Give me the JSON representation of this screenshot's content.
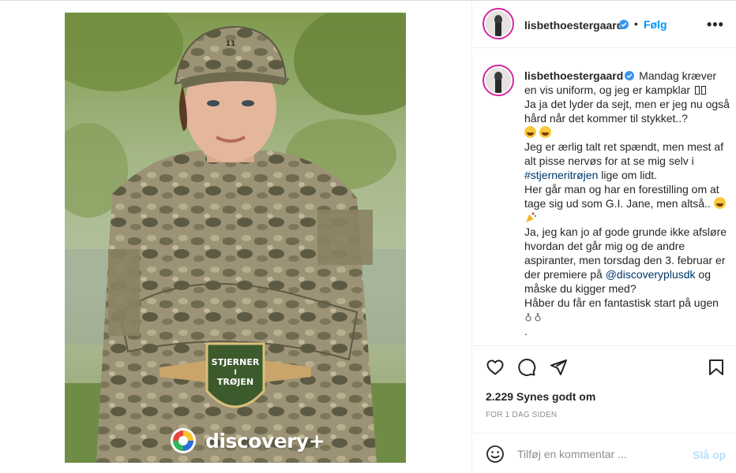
{
  "post": {
    "username": "lisbethoestergaard",
    "follow_label": "Følg",
    "separator": "•",
    "more_label": "•••",
    "media": {
      "badge_line1": "STJERNER",
      "badge_line2": "I",
      "badge_line3": "TRØJEN",
      "brand": "discovery+",
      "cap_number": "11"
    },
    "caption": {
      "line1": "Mandag kræver en vis uniform, og jeg er kampklar",
      "line2": "Ja ja det lyder da sejt, men er jeg nu også hård når det kommer til stykket..?",
      "line3_a": "Jeg er ærlig talt ret spændt, men mest af alt pisse nervøs for at se mig selv i ",
      "hashtag": "#stjerneritrøjen",
      "line3_b": " lige om lidt.",
      "line4": "Her går man og har en forestilling om at tage sig ud som G.I. Jane, men altså..",
      "line5_a": "Ja, jeg kan jo af gode grunde ikke afsløre hvordan det går mig og de andre aspiranter, men torsdag den 3. februar er der premiere på ",
      "mention": "@discoveryplusdk",
      "line5_b": " og måske du kigger med?",
      "line6": "Håber du får en fantastisk start på ugen",
      "line7": "."
    },
    "likes": "2.229 Synes godt om",
    "time": "FOR 1 DAG SIDEN",
    "comment": {
      "placeholder": "Tilføj en kommentar ...",
      "post_label": "Slå op"
    }
  },
  "icons": {
    "like": "heart-icon",
    "comment": "comment-bubble-icon",
    "share": "paper-plane-icon",
    "save": "bookmark-icon",
    "emoji": "smiley-icon",
    "verified": "verified-badge-icon"
  },
  "colors": {
    "accent": "#0095f6",
    "link": "#00376b",
    "muted": "#8e8e8e",
    "post_disabled": "#b2dffc",
    "verified": "#3897f0"
  }
}
